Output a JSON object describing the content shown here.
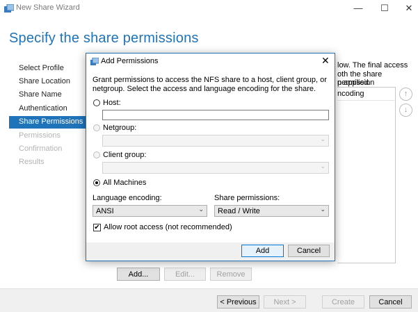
{
  "window": {
    "title": "New Share Wizard",
    "minimize_glyph": "—",
    "maximize_glyph": "☐",
    "close_glyph": "✕"
  },
  "page_heading": "Specify the share permissions",
  "nav": {
    "items": [
      {
        "label": "Select Profile",
        "state": "done"
      },
      {
        "label": "Share Location",
        "state": "done"
      },
      {
        "label": "Share Name",
        "state": "done"
      },
      {
        "label": "Authentication",
        "state": "done"
      },
      {
        "label": "Share Permissions",
        "state": "selected"
      },
      {
        "label": "Permissions",
        "state": "disabled"
      },
      {
        "label": "Confirmation",
        "state": "disabled"
      },
      {
        "label": "Results",
        "state": "disabled"
      }
    ]
  },
  "background_panel": {
    "text_lines": [
      "low. The final access",
      "oth the share permission",
      "n applied."
    ],
    "list_header_fragment": "ncoding",
    "move_up_glyph": "↑",
    "move_down_glyph": "↓",
    "add_label": "Add...",
    "edit_label": "Edit...",
    "remove_label": "Remove"
  },
  "footer": {
    "previous_label": "< Previous",
    "next_label": "Next >",
    "create_label": "Create",
    "cancel_label": "Cancel"
  },
  "dialog": {
    "title": "Add Permissions",
    "close_glyph": "✕",
    "description": "Grant permissions to access the NFS share to a host, client group, or netgroup. Select the access and language encoding for the share.",
    "options": {
      "host_label": "Host:",
      "host_value": "",
      "netgroup_label": "Netgroup:",
      "client_group_label": "Client group:",
      "all_machines_label": "All Machines",
      "selected": "all_machines"
    },
    "language_encoding": {
      "label": "Language encoding:",
      "value": "ANSI"
    },
    "share_permissions": {
      "label": "Share permissions:",
      "value": "Read / Write"
    },
    "allow_root": {
      "label": "Allow root access (not recommended)",
      "checked": true,
      "check_glyph": "✔"
    },
    "add_label": "Add",
    "cancel_label": "Cancel"
  },
  "colors": {
    "accent": "#1e73b9",
    "disabled_text": "#b4b4b4"
  }
}
